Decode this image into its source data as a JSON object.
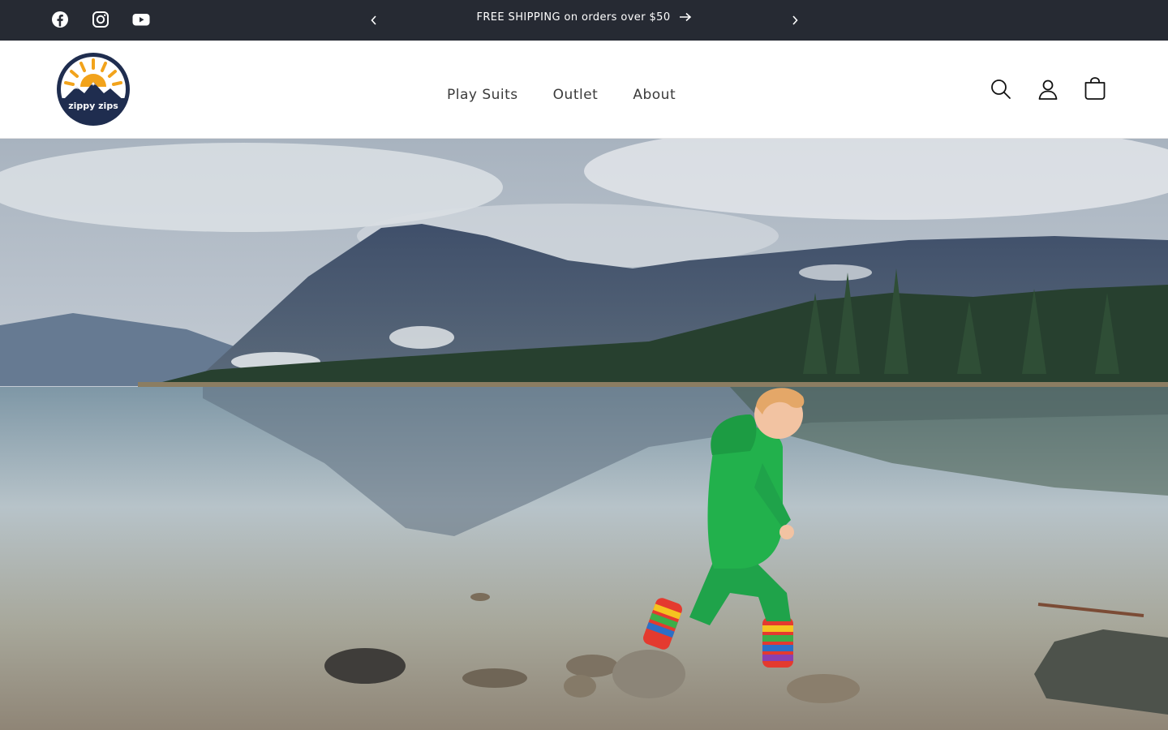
{
  "announcement": {
    "text": "FREE SHIPPING on orders over $50",
    "prev_icon": "chevron-left-icon",
    "next_icon": "chevron-right-icon",
    "arrow_icon": "arrow-right-icon"
  },
  "social": [
    {
      "name": "facebook-icon",
      "label": "Facebook"
    },
    {
      "name": "instagram-icon",
      "label": "Instagram"
    },
    {
      "name": "youtube-icon",
      "label": "YouTube"
    }
  ],
  "brand": {
    "logo_text": "zippy zips",
    "colors": {
      "navy": "#1f2d4f",
      "sun": "#f2a31b",
      "bar": "#262a33"
    }
  },
  "nav": {
    "items": [
      {
        "label": "Play Suits"
      },
      {
        "label": "Outlet"
      },
      {
        "label": "About"
      }
    ]
  },
  "header_icons": [
    "search-icon",
    "account-icon",
    "cart-icon"
  ],
  "hero": {
    "image": "child in green suit and rainbow boots stepping on rocks by a mountain lake"
  }
}
